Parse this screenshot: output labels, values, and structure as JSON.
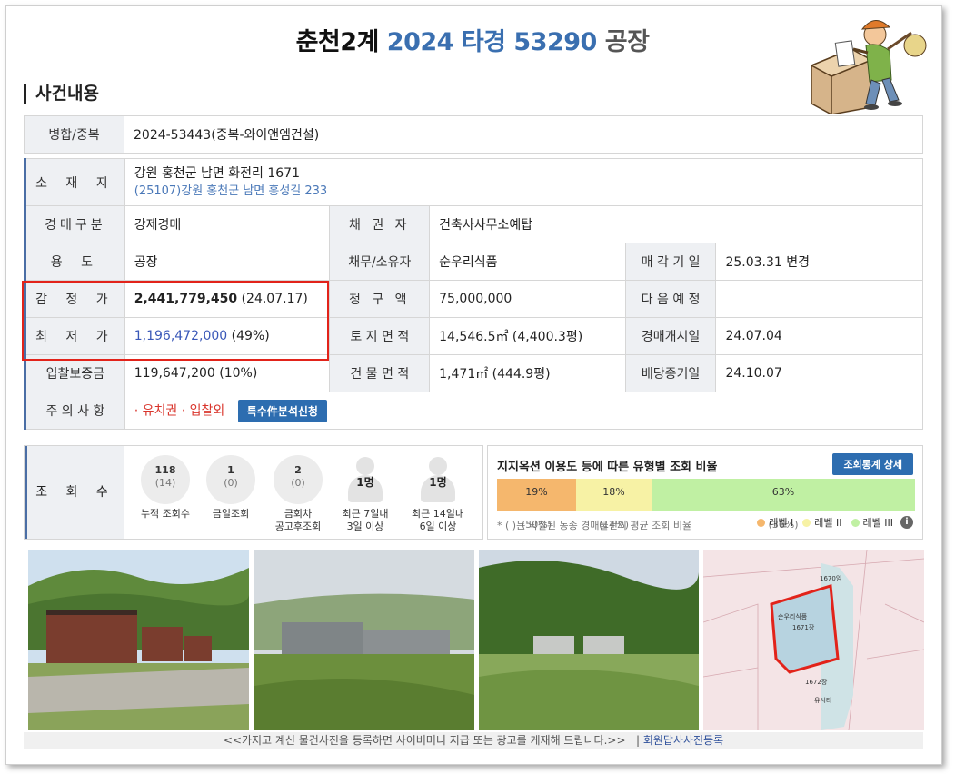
{
  "header": {
    "court": "춘천2계",
    "case_no": "2024 타경 53290",
    "category": "공장"
  },
  "section_title": "사건내용",
  "merge": {
    "label": "병합/중복",
    "value": "2024-53443(중복-와이앤엠건설)"
  },
  "location": {
    "label": "소 재 지",
    "address": "강원 홍천군 남면 화전리 1671",
    "road_address": "(25107)강원 홍천군  남면 홍성길  233"
  },
  "rows": {
    "auction_type": {
      "label": "경매구분",
      "value": "강제경매"
    },
    "creditor": {
      "label": "채 권 자",
      "value": "건축사사무소예탑"
    },
    "usage": {
      "label": "용   도",
      "value": "공장"
    },
    "debtor": {
      "label": "채무/소유자",
      "value": "순우리식품"
    },
    "sale_date": {
      "label": "매 각 기 일",
      "value": "25.03.31   변경"
    },
    "appraisal": {
      "label": "감 정 가",
      "amount": "2,441,779,450",
      "extra": " (24.07.17)"
    },
    "claim": {
      "label": "청 구 액",
      "value": "75,000,000"
    },
    "next_date": {
      "label": "다 음 예 정",
      "value": ""
    },
    "minimum": {
      "label": "최 저 가",
      "amount": "1,196,472,000",
      "extra": " (49%)"
    },
    "land_area": {
      "label": "토 지 면 적",
      "value": "14,546.5㎡ (4,400.3평)"
    },
    "start_date": {
      "label": "경매개시일",
      "value": "24.07.04"
    },
    "deposit": {
      "label": "입찰보증금",
      "value": "119,647,200 (10%)"
    },
    "building_area": {
      "label": "건 물 면 적",
      "value": "1,471㎡ (444.9평)"
    },
    "dividend_date": {
      "label": "배당종기일",
      "value": "24.10.07"
    },
    "notice": {
      "label": "주 의 사 항",
      "value": "· 유치권 · 입찰외",
      "button": "특수件분석신청"
    }
  },
  "views": {
    "label": "조 회 수",
    "items": [
      {
        "count": "118",
        "sub": "(14)",
        "caption1": "누적 조회수",
        "caption2": ""
      },
      {
        "count": "1",
        "sub": "(0)",
        "caption1": "금일조회",
        "caption2": ""
      },
      {
        "count": "2",
        "sub": "(0)",
        "caption1": "금회차",
        "caption2": "공고후조회"
      },
      {
        "count": "1명",
        "sub": "",
        "caption1": "최근 7일내",
        "caption2": "3일 이상"
      },
      {
        "count": "1명",
        "sub": "",
        "caption1": "최근 14일내",
        "caption2": "6일 이상"
      }
    ]
  },
  "ratio": {
    "title": "지지옥션 이용도 등에 따른 유형별 조회 비율",
    "button": "조회통계 상세",
    "bars": [
      {
        "pct": "19%",
        "avg": "(50%)",
        "share": 0.19,
        "color": "#f5b76d"
      },
      {
        "pct": "18%",
        "avg": "(14%)",
        "share": 0.18,
        "color": "#f7f2a5"
      },
      {
        "pct": "63%",
        "avg": "(36%)",
        "share": 0.63,
        "color": "#c0f0a3"
      }
    ],
    "note": "* ( )는 낙찰된 동종 경매물건의 평균 조회 비율",
    "legend": [
      "레벨 I",
      "레벨 II",
      "레벨 III"
    ],
    "info_icon": "i"
  },
  "map_labels": {
    "company": "순우리식품",
    "lot": "1671장",
    "lot2": "1670임",
    "lot3": "1672장",
    "road": "유시티"
  },
  "footer": {
    "text": "<<가지고 계신 물건사진을 등록하면 사이버머니 지급 또는 광고를 게재해 드립니다.>>",
    "sep": "|",
    "link": "회원답사사진등록"
  }
}
